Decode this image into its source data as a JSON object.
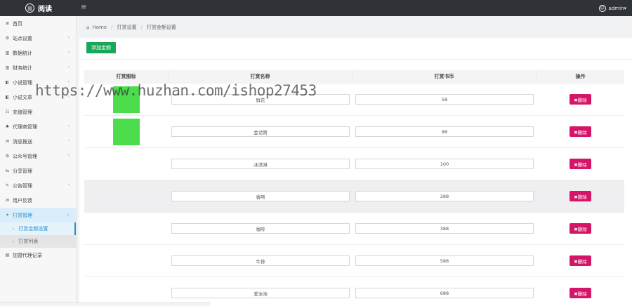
{
  "header": {
    "brand_icon": "▥",
    "brand_name": "阅读",
    "menu_icon": "≡",
    "user_icon": "☺",
    "user_label": "admin▾"
  },
  "sidebar": {
    "items": [
      {
        "icon": "≣",
        "label": "首页",
        "arrow": ""
      },
      {
        "icon": "⚙",
        "label": "站点设置",
        "arrow": "‹"
      },
      {
        "icon": "▥",
        "label": "数据统计",
        "arrow": "‹"
      },
      {
        "icon": "▥",
        "label": "财务统计",
        "arrow": "‹"
      },
      {
        "icon": "◧",
        "label": "小说管理",
        "arrow": "‹"
      },
      {
        "icon": "◧",
        "label": "小说文章",
        "arrow": "‹"
      },
      {
        "icon": "☷",
        "label": "充值管理",
        "arrow": ""
      },
      {
        "icon": "♣",
        "label": "代理商管理",
        "arrow": "‹"
      },
      {
        "icon": "✉",
        "label": "消息推送",
        "arrow": "‹"
      },
      {
        "icon": "⚙",
        "label": "公众号管理",
        "arrow": "‹"
      },
      {
        "icon": "⇆",
        "label": "分享管理",
        "arrow": ""
      },
      {
        "icon": "✎",
        "label": "公告管理",
        "arrow": "‹"
      },
      {
        "icon": "✉",
        "label": "用户反馈",
        "arrow": ""
      }
    ],
    "open_item": {
      "icon": "✦",
      "label": "打赏管理",
      "arrow": "⌄"
    },
    "sub_items": [
      {
        "icon": "›",
        "label": "打赏金额设置"
      },
      {
        "icon": "›",
        "label": "打赏列表"
      }
    ],
    "last_item": {
      "icon": "▤",
      "label": "加盟代理记录"
    }
  },
  "breadcrumb": {
    "home_icon": "⌂",
    "home": "Home",
    "sep": "/",
    "level1": "打赏设置",
    "level2": "打赏金额设置"
  },
  "toolbar": {
    "add_label": "添加金额"
  },
  "table": {
    "headers": [
      "打赏图标",
      "打赏名称",
      "打赏书币",
      "操作"
    ],
    "delete_label": "✖删除",
    "rows": [
      {
        "has_image": true,
        "name": "鲜花",
        "coins": "58"
      },
      {
        "has_image": true,
        "name": "金话筒",
        "coins": "88"
      },
      {
        "has_image": false,
        "name": "冰淇淋",
        "coins": "100"
      },
      {
        "has_image": false,
        "name": "香吻",
        "coins": "288"
      },
      {
        "has_image": false,
        "name": "咖啡",
        "coins": "388"
      },
      {
        "has_image": false,
        "name": "牛排",
        "coins": "588"
      },
      {
        "has_image": false,
        "name": "爱泳池",
        "coins": "688"
      }
    ]
  },
  "watermark": "https://www.huzhan.com/ishop27453",
  "colors": {
    "topbar": "#2f3338",
    "add_button": "#1aa758",
    "delete_button": "#d51567",
    "active_link": "#2a8fd0",
    "gift_image": "#4cdc4c"
  }
}
